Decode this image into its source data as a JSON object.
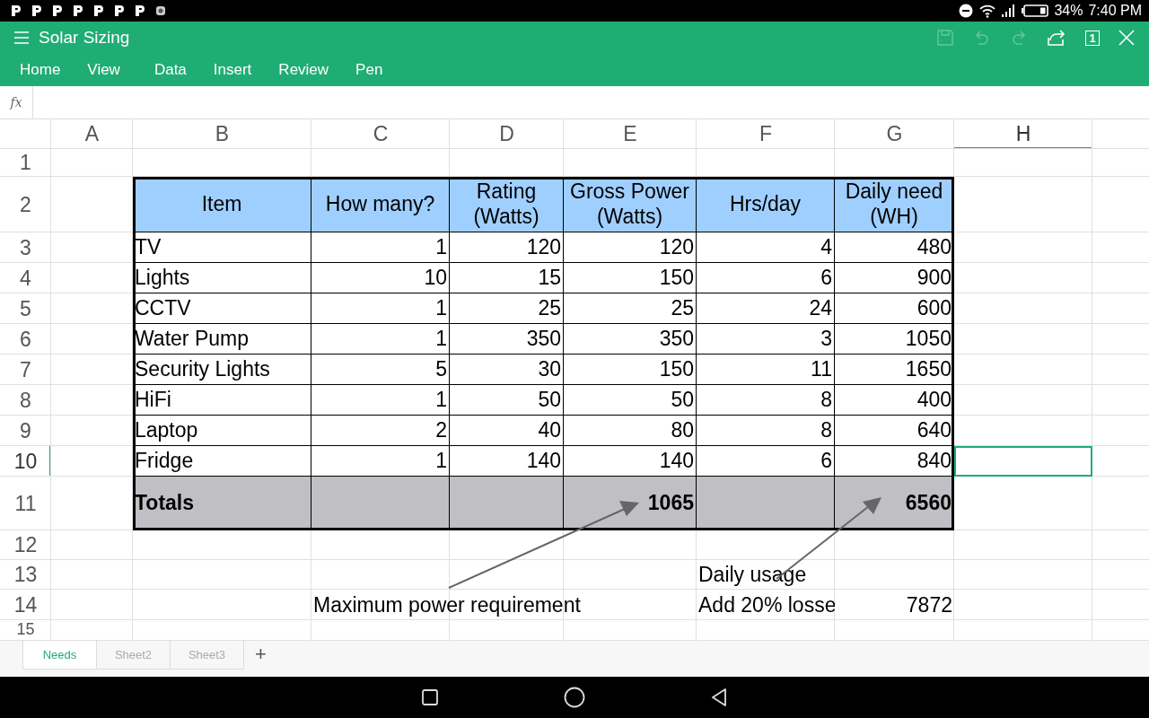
{
  "status_bar": {
    "battery": "34%",
    "time": "7:40 PM"
  },
  "title_bar": {
    "title": "Solar Sizing",
    "tools": [
      {
        "kind": "save",
        "disabled": true
      },
      {
        "kind": "undo",
        "disabled": true
      },
      {
        "kind": "redo",
        "disabled": true
      },
      {
        "kind": "share",
        "disabled": false
      },
      {
        "kind": "count",
        "disabled": false,
        "text": "1"
      },
      {
        "kind": "close",
        "disabled": false
      }
    ]
  },
  "menu": [
    "Home",
    "View",
    "Data",
    "Insert",
    "Review",
    "Pen"
  ],
  "formula_bar": {
    "label": "fx"
  },
  "columns": [
    {
      "label": "A",
      "selected": false
    },
    {
      "label": "B",
      "selected": false
    },
    {
      "label": "C",
      "selected": false
    },
    {
      "label": "D",
      "selected": false
    },
    {
      "label": "E",
      "selected": false
    },
    {
      "label": "F",
      "selected": false
    },
    {
      "label": "G",
      "selected": false
    },
    {
      "label": "H",
      "selected": true
    }
  ],
  "row_numbers": [
    {
      "label": "1",
      "selected": false
    },
    {
      "label": "2",
      "selected": false
    },
    {
      "label": "3",
      "selected": false
    },
    {
      "label": "4",
      "selected": false
    },
    {
      "label": "5",
      "selected": false
    },
    {
      "label": "6",
      "selected": false
    },
    {
      "label": "7",
      "selected": false
    },
    {
      "label": "8",
      "selected": false
    },
    {
      "label": "9",
      "selected": false
    },
    {
      "label": "10",
      "selected": true
    },
    {
      "label": "11",
      "selected": false
    },
    {
      "label": "12",
      "selected": false
    },
    {
      "label": "13",
      "selected": false
    },
    {
      "label": "14",
      "selected": false
    },
    {
      "label": "15",
      "selected": false
    }
  ],
  "table": {
    "header": [
      "Item",
      "How many?",
      "Rating (Watts)",
      "Gross Power (Watts)",
      "Hrs/day",
      "Daily need (WH)"
    ],
    "rows": [
      [
        "TV",
        "1",
        "120",
        "120",
        "4",
        "480"
      ],
      [
        "Lights",
        "10",
        "15",
        "150",
        "6",
        "900"
      ],
      [
        "CCTV",
        "1",
        "25",
        "25",
        "24",
        "600"
      ],
      [
        "Water Pump",
        "1",
        "350",
        "350",
        "3",
        "1050"
      ],
      [
        "Security Lights",
        "5",
        "30",
        "150",
        "11",
        "1650"
      ],
      [
        "HiFi",
        "1",
        "50",
        "50",
        "8",
        "400"
      ],
      [
        "Laptop",
        "2",
        "40",
        "80",
        "8",
        "640"
      ],
      [
        "Fridge",
        "1",
        "140",
        "140",
        "6",
        "840"
      ]
    ],
    "totals": {
      "label": "Totals",
      "gross_power": "1065",
      "daily_need": "6560"
    }
  },
  "notes": {
    "daily_usage": "Daily usage",
    "max_power": "Maximum power requirement",
    "losses_label": "Add 20% losse",
    "losses_value": "7872"
  },
  "sheets": [
    {
      "label": "Needs",
      "selected": true
    },
    {
      "label": "Sheet2",
      "selected": false
    },
    {
      "label": "Sheet3",
      "selected": false
    }
  ],
  "add_sheet": "+"
}
